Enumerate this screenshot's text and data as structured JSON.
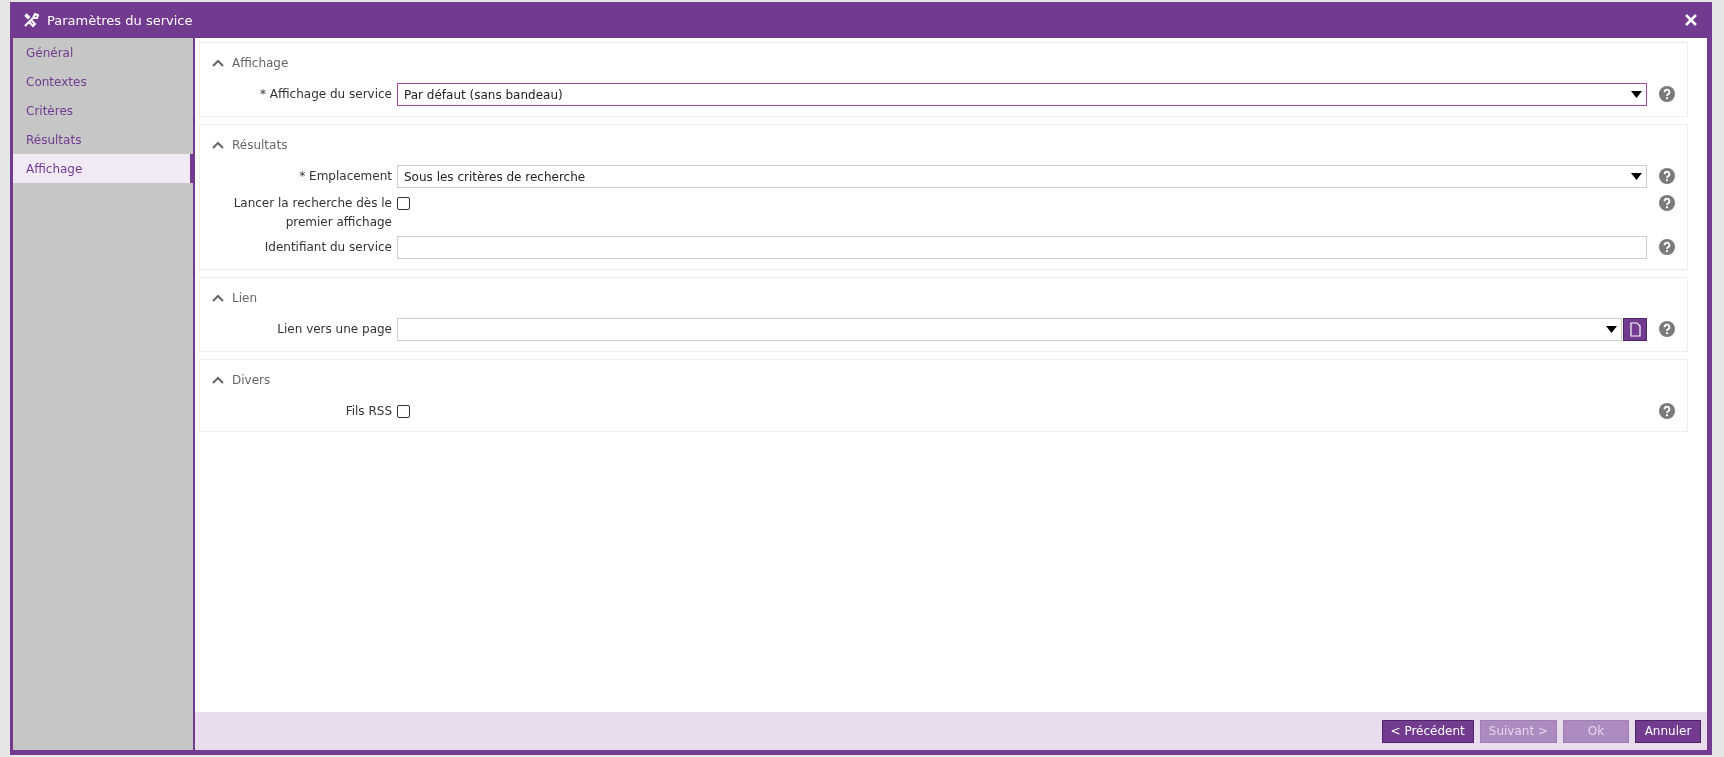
{
  "window": {
    "title": "Paramètres du service"
  },
  "sidebar": {
    "items": [
      {
        "label": "Général",
        "selected": false
      },
      {
        "label": "Contextes",
        "selected": false
      },
      {
        "label": "Critères",
        "selected": false
      },
      {
        "label": "Résultats",
        "selected": false
      },
      {
        "label": "Affichage",
        "selected": true
      }
    ]
  },
  "sections": [
    {
      "title": "Affichage",
      "expanded": true,
      "fields": [
        {
          "kind": "select",
          "label": "* Affichage du service",
          "value": "Par défaut (sans bandeau)",
          "focused": true
        }
      ]
    },
    {
      "title": "Résultats",
      "expanded": true,
      "fields": [
        {
          "kind": "select",
          "label": "* Emplacement",
          "value": "Sous les critères de recherche",
          "focused": false
        },
        {
          "kind": "checkbox",
          "label": "Lancer la recherche dès le premier affichage",
          "checked": false
        },
        {
          "kind": "text",
          "label": "Identifiant du service",
          "focused": false
        }
      ]
    },
    {
      "title": "Lien",
      "expanded": true,
      "fields": [
        {
          "kind": "page-select",
          "label": "Lien vers une page",
          "focused": false
        }
      ]
    },
    {
      "title": "Divers",
      "expanded": true,
      "fields": [
        {
          "kind": "checkbox",
          "label": "Fils RSS",
          "checked": false
        }
      ]
    }
  ],
  "buttons": [
    {
      "label": "< Précédent",
      "disabled": false
    },
    {
      "label": "Suivant >",
      "disabled": true
    },
    {
      "label": "Ok",
      "disabled": true
    },
    {
      "label": "Annuler",
      "disabled": false
    }
  ]
}
